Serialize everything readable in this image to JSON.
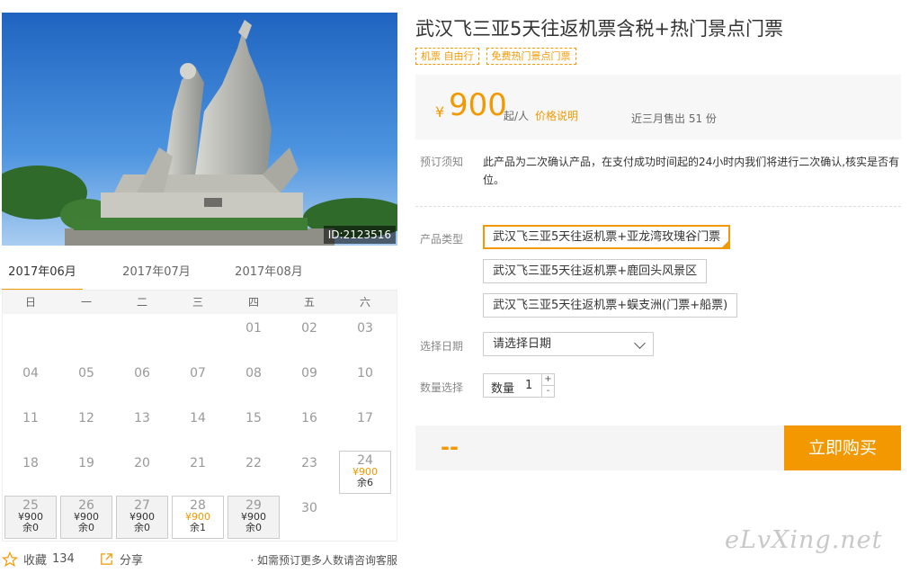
{
  "photo": {
    "id_label": "ID:2123516"
  },
  "calendar": {
    "months": [
      "2017年06月",
      "2017年07月",
      "2017年08月"
    ],
    "active_month": 0,
    "weekdays": [
      "日",
      "一",
      "二",
      "三",
      "四",
      "五",
      "六"
    ],
    "cells": [
      {
        "day": "01",
        "col": 4,
        "row": 0
      },
      {
        "day": "02",
        "col": 5,
        "row": 0
      },
      {
        "day": "03",
        "col": 6,
        "row": 0
      },
      {
        "day": "04",
        "col": 0,
        "row": 1
      },
      {
        "day": "05",
        "col": 1,
        "row": 1
      },
      {
        "day": "06",
        "col": 2,
        "row": 1
      },
      {
        "day": "07",
        "col": 3,
        "row": 1
      },
      {
        "day": "08",
        "col": 4,
        "row": 1
      },
      {
        "day": "09",
        "col": 5,
        "row": 1
      },
      {
        "day": "10",
        "col": 6,
        "row": 1
      },
      {
        "day": "11",
        "col": 0,
        "row": 2
      },
      {
        "day": "12",
        "col": 1,
        "row": 2
      },
      {
        "day": "13",
        "col": 2,
        "row": 2
      },
      {
        "day": "14",
        "col": 3,
        "row": 2
      },
      {
        "day": "15",
        "col": 4,
        "row": 2
      },
      {
        "day": "16",
        "col": 5,
        "row": 2
      },
      {
        "day": "17",
        "col": 6,
        "row": 2
      },
      {
        "day": "18",
        "col": 0,
        "row": 3
      },
      {
        "day": "19",
        "col": 1,
        "row": 3
      },
      {
        "day": "20",
        "col": 2,
        "row": 3
      },
      {
        "day": "21",
        "col": 3,
        "row": 3
      },
      {
        "day": "22",
        "col": 4,
        "row": 3
      },
      {
        "day": "23",
        "col": 5,
        "row": 3
      },
      {
        "day": "24",
        "col": 6,
        "row": 3,
        "price": "¥900",
        "remain": "余6",
        "style": "white-hot"
      },
      {
        "day": "25",
        "col": 0,
        "row": 4,
        "price": "¥900",
        "remain": "余0",
        "style": "grey"
      },
      {
        "day": "26",
        "col": 1,
        "row": 4,
        "price": "¥900",
        "remain": "余0",
        "style": "grey"
      },
      {
        "day": "27",
        "col": 2,
        "row": 4,
        "price": "¥900",
        "remain": "余0",
        "style": "grey"
      },
      {
        "day": "28",
        "col": 3,
        "row": 4,
        "price": "¥900",
        "remain": "余1",
        "style": "white-hot"
      },
      {
        "day": "29",
        "col": 4,
        "row": 4,
        "price": "¥900",
        "remain": "余0",
        "style": "grey"
      },
      {
        "day": "30",
        "col": 5,
        "row": 4
      }
    ]
  },
  "bottom": {
    "favorite_label": "收藏",
    "favorite_count": "134",
    "share_label": "分享",
    "note": "· 如需预订更多人数请咨询客服"
  },
  "product": {
    "title": "武汉飞三亚5天往返机票含税+热门景点门票",
    "tags": [
      "机票 自由行",
      "免费热门景点门票"
    ],
    "currency": "¥",
    "price": "900",
    "per": "起/人",
    "price_explain": "价格说明",
    "sold": "近三月售出 51 份"
  },
  "booking": {
    "notice_label": "预订须知",
    "notice_text": "此产品为二次确认产品，在支付成功时间起的24小时内我们将进行二次确认,核实是否有位。",
    "type_label": "产品类型",
    "types": [
      "武汉飞三亚5天往返机票+亚龙湾玫瑰谷门票",
      "武汉飞三亚5天往返机票+鹿回头风景区",
      "武汉飞三亚5天往返机票+蜈支洲(门票+船票)"
    ],
    "selected_type": 0,
    "date_label": "选择日期",
    "date_placeholder": "请选择日期",
    "qty_label": "数量选择",
    "qty_inner_label": "数量",
    "qty_value": "1",
    "qty_plus": "+",
    "qty_minus": "-",
    "total": "--",
    "buy_label": "立即购买"
  },
  "watermark": "eLvXing.net",
  "colors": {
    "accent": "#f39800",
    "sky": "#2a6fc4",
    "muted_bg": "#f7f7f7"
  }
}
